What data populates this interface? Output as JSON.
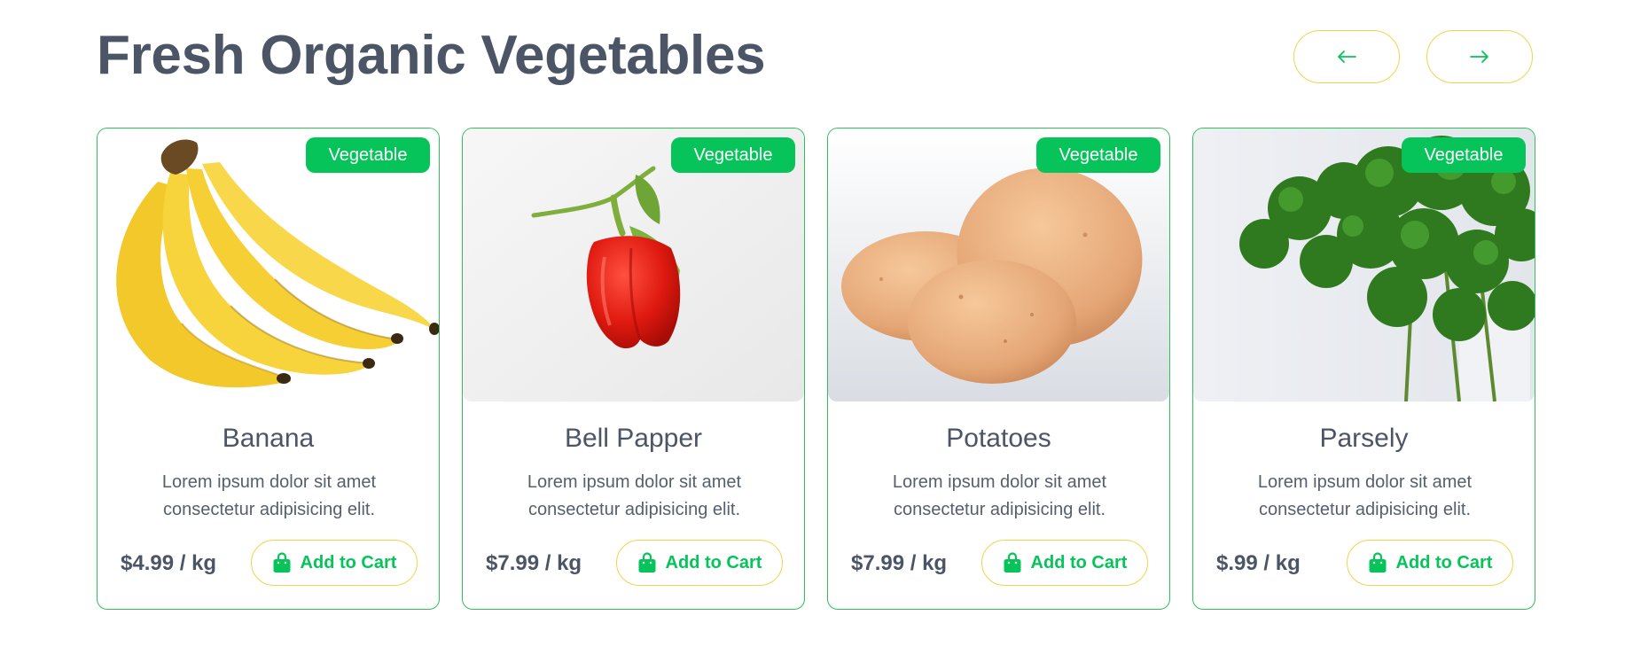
{
  "header": {
    "title": "Fresh Organic Vegetables",
    "prev_icon": "arrow-left-icon",
    "next_icon": "arrow-right-icon"
  },
  "colors": {
    "accent_green": "#06c45a",
    "button_border_yellow": "#f2d34c",
    "text_slate": "#4b5566"
  },
  "products": [
    {
      "badge": "Vegetable",
      "name": "Banana",
      "description": "Lorem ipsum dolor sit amet consectetur adipisicing elit.",
      "price": "$4.99 / kg",
      "cart_label": "Add to Cart",
      "cart_icon": "shopping-bag-icon"
    },
    {
      "badge": "Vegetable",
      "name": "Bell Papper",
      "description": "Lorem ipsum dolor sit amet consectetur adipisicing elit.",
      "price": "$7.99 / kg",
      "cart_label": "Add to Cart",
      "cart_icon": "shopping-bag-icon"
    },
    {
      "badge": "Vegetable",
      "name": "Potatoes",
      "description": "Lorem ipsum dolor sit amet consectetur adipisicing elit.",
      "price": "$7.99 / kg",
      "cart_label": "Add to Cart",
      "cart_icon": "shopping-bag-icon"
    },
    {
      "badge": "Vegetable",
      "name": "Parsely",
      "description": "Lorem ipsum dolor sit amet consectetur adipisicing elit.",
      "price": "$.99 / kg",
      "cart_label": "Add to Cart",
      "cart_icon": "shopping-bag-icon"
    }
  ]
}
